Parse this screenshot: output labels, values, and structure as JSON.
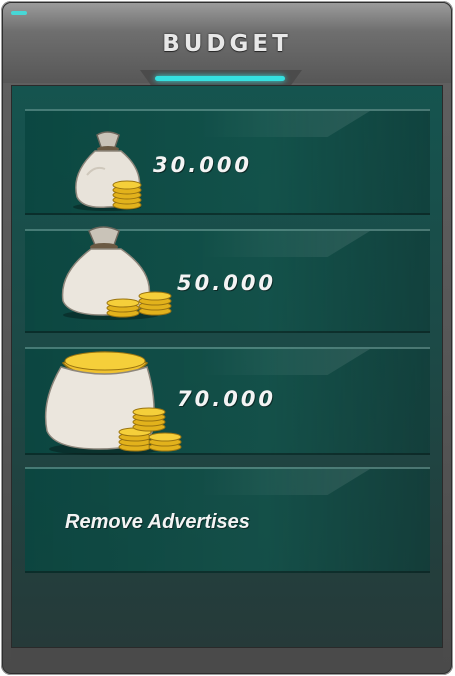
{
  "header": {
    "title": "BUDGET"
  },
  "items": [
    {
      "amount": "30.000",
      "icon": "money-bag-small-icon"
    },
    {
      "amount": "50.000",
      "icon": "money-bag-medium-icon"
    },
    {
      "amount": "70.000",
      "icon": "money-bag-large-icon"
    }
  ],
  "remove_ads": {
    "label": "Remove Advertises"
  },
  "colors": {
    "accent": "#35e0e0",
    "panel": "#15544f",
    "frame": "#5f5f5f",
    "coin": "#e2b21c"
  }
}
